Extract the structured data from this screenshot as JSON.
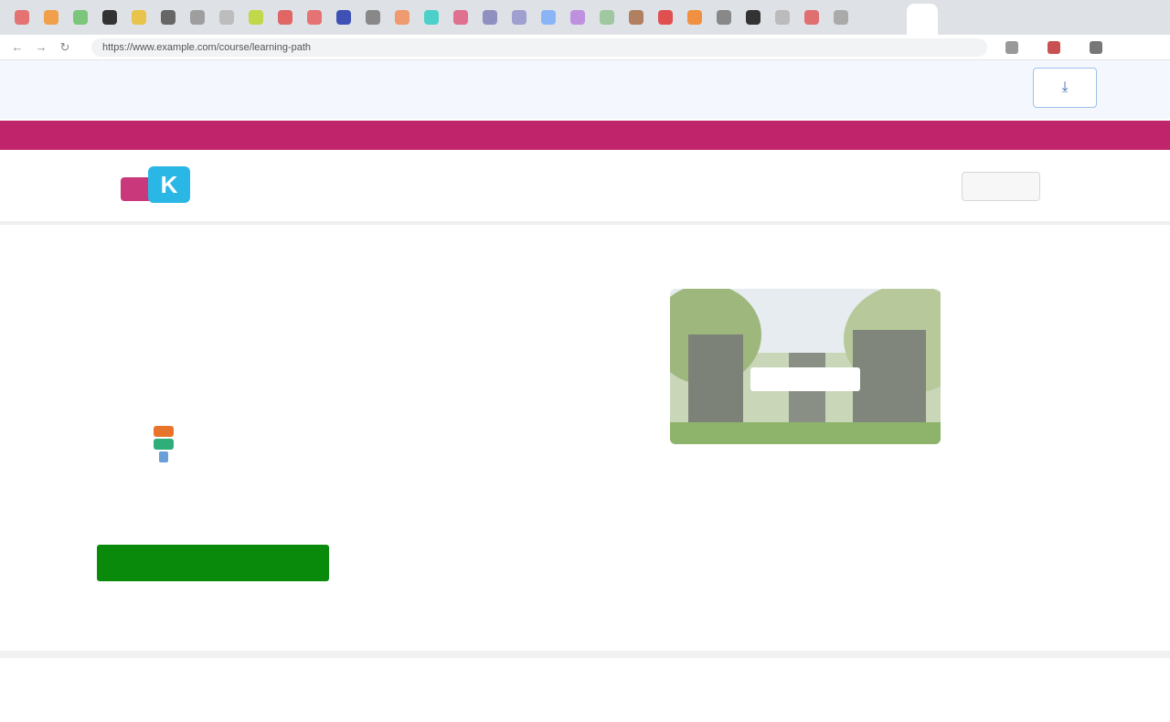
{
  "browser": {
    "tab_colors": [
      "#e57373",
      "#f0a04b",
      "#7bc67b",
      "#333333",
      "#e8c44a",
      "#666666",
      "#9e9e9e",
      "#bdbdbd",
      "#c0d84a",
      "#e06666",
      "#e57373",
      "#3f51b5",
      "#888888",
      "#ef9a6f",
      "#4dd0c8",
      "#e07090",
      "#9090c0",
      "#a0a0d0",
      "#8ab4f8",
      "#c090e0",
      "#a0c8a0",
      "#b08060",
      "#e05050",
      "#f09040",
      "#888888",
      "#333333",
      "#bbbbbb",
      "#e07070",
      "#aaaaaa"
    ],
    "url": "https://www.example.com/course/learning-path",
    "extension_colors": [
      "#999999",
      "#c85050",
      "#777777"
    ]
  },
  "notice": {
    "text": "",
    "button_label": "⤓"
  },
  "promo": {
    "text": ""
  },
  "header": {
    "nav": [
      {
        "label": ""
      },
      {
        "label": ""
      },
      {
        "label": ""
      },
      {
        "label": ""
      }
    ],
    "search_label": "",
    "login_label": "",
    "join_label": ""
  },
  "main": {
    "breadcrumb": "",
    "title": "",
    "description": "",
    "author_name": "",
    "hero_label": "",
    "enroll_label": "",
    "enroll_button": "",
    "enroll_note": ""
  },
  "footer": {
    "brand": "",
    "links": [
      {
        "label": ""
      },
      {
        "label": ""
      }
    ]
  }
}
